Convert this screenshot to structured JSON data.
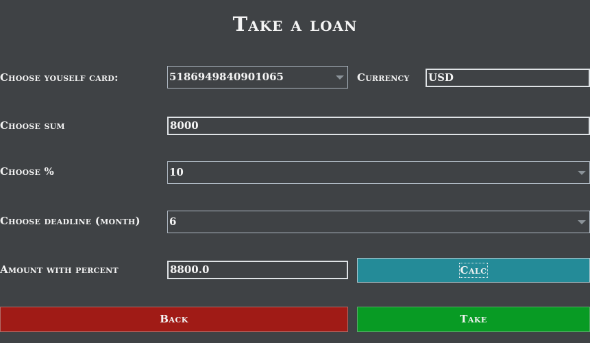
{
  "title": "Take a loan",
  "card": {
    "label": "Choose youself card:",
    "value": "5186949840901065"
  },
  "currency": {
    "label": "Currency",
    "value": "USD"
  },
  "sum": {
    "label": "Choose sum",
    "value": "8000"
  },
  "percent": {
    "label": "Choose %",
    "value": "10"
  },
  "deadline": {
    "label": "Choose deadline (month)",
    "value": "6"
  },
  "amount": {
    "label": "Amount with percent",
    "value": "8800.0"
  },
  "buttons": {
    "calc": "Calc",
    "back": "Back",
    "take": "Take"
  },
  "colors": {
    "background": "#3f4245",
    "calc": "#248b98",
    "back": "#a01b16",
    "take": "#089b24"
  }
}
